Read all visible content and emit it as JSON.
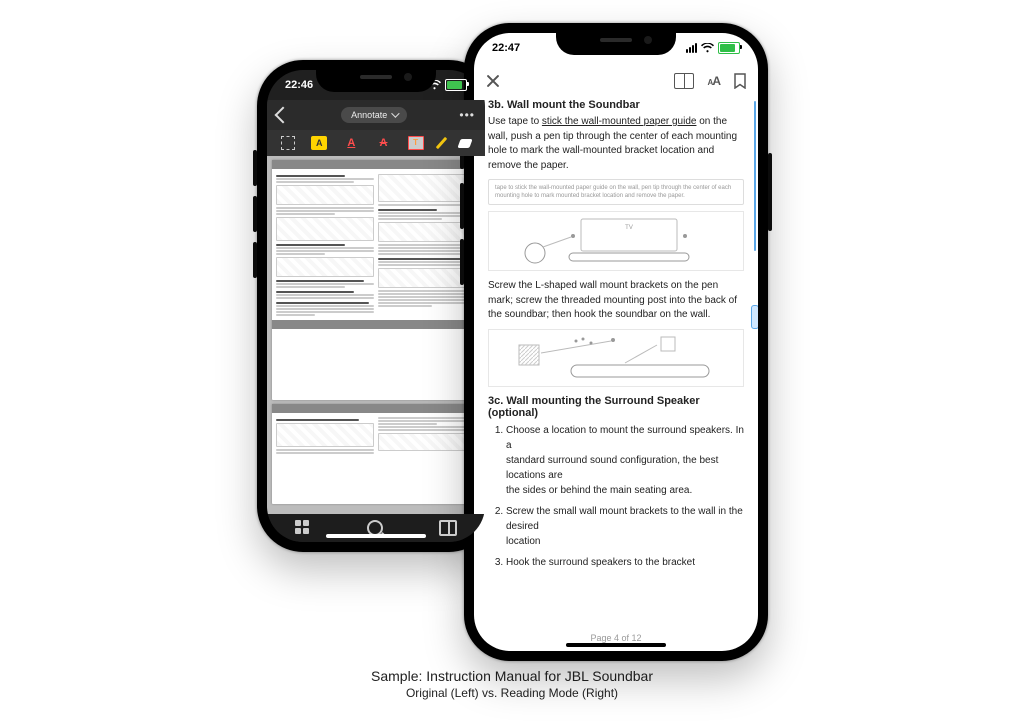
{
  "caption": {
    "title": "Sample: Instruction Manual for JBL Soundbar",
    "subtitle": "Original (Left) vs. Reading Mode (Right)"
  },
  "left_phone": {
    "status": {
      "time": "22:46"
    },
    "nav": {
      "mode_label": "Annotate"
    },
    "tools": {
      "select": "select",
      "highlight_glyph": "A",
      "underline_glyph": "A",
      "strike_glyph": "A",
      "textbox_glyph": "T",
      "pen": "pen",
      "eraser": "eraser"
    },
    "doc_preview": {
      "headings": {
        "h1": "3b. Wall mount the Soundbar",
        "h2": "3c. Wall mounting the Surround Speaker (optional)",
        "h3": "4. CONNECT YOUR SOUNDBAR",
        "h4": "Connecting the Soundbar to your TV",
        "h5": "Connecting to TV through HDMI (ARC)",
        "h6": "Connect to TV through Optical",
        "h7": "Connecting the soundbar to other devices"
      }
    },
    "tabbar": {
      "grid": "thumbnails",
      "search": "search",
      "book": "reading-mode"
    }
  },
  "right_phone": {
    "status": {
      "time": "22:47"
    },
    "toolbar": {
      "close": "close",
      "book": "library",
      "font": "aA",
      "bookmark": "bookmark"
    },
    "content": {
      "h_3b": "3b. Wall mount the Soundbar",
      "p1_a": "Use tape to ",
      "p1_u": "stick the wall-mounted paper guide",
      "p1_b": " on the wall, push a pen tip through the center of each mounting hole to mark the wall-mounted bracket location and remove the paper.",
      "callout": "tape to stick the wall-mounted paper guide on the wall, pen tip through the center of each mounting hole to mark mounted bracket location and remove the paper.",
      "fig1_label": "TV",
      "p2": "Screw the L-shaped wall mount brackets on the pen mark; screw the threaded mounting post into the back of the soundbar; then hook the soundbar on the wall.",
      "h_3c": "3c. Wall mounting the Surround Speaker (optional)",
      "steps": {
        "s1a": "Choose a location to mount the surround speakers. In a",
        "s1b": "standard surround sound configuration, the best locations are",
        "s1c": "the sides or behind the main seating area.",
        "s2a": "Screw the small wall mount brackets to the wall in the desired",
        "s2b": "location",
        "s3": "Hook the surround speakers to the bracket"
      }
    },
    "footer": {
      "page_label": "Page 4 of 12"
    }
  }
}
